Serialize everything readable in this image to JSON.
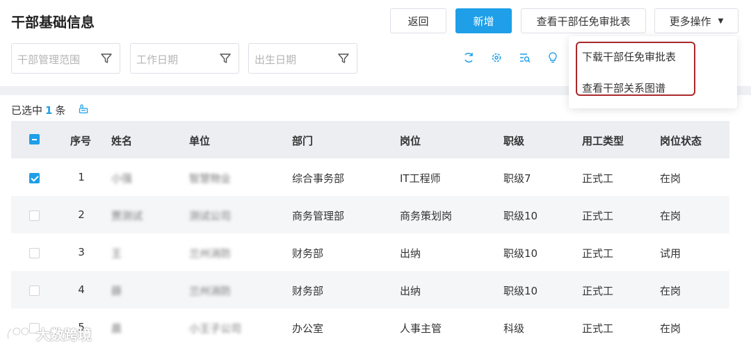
{
  "header": {
    "title": "干部基础信息"
  },
  "toolbar": {
    "back_label": "返回",
    "add_label": "新增",
    "view_approval_label": "查看干部任免审批表",
    "more_label": "更多操作"
  },
  "filters": {
    "scope_placeholder": "干部管理范围",
    "work_date_placeholder": "工作日期",
    "birth_date_placeholder": "出生日期"
  },
  "tools": {
    "icons": [
      "refresh-icon",
      "settings-icon",
      "search-list-icon",
      "bulb-icon"
    ]
  },
  "selection": {
    "prefix": "已选中",
    "count": "1",
    "suffix": "条"
  },
  "table": {
    "headers": {
      "index": "序号",
      "name": "姓名",
      "unit": "单位",
      "dept": "部门",
      "post": "岗位",
      "level": "职级",
      "employment": "用工类型",
      "status": "岗位状态"
    },
    "rows": [
      {
        "checked": true,
        "index": "1",
        "name": "小强",
        "unit": "智慧物业",
        "dept": "综合事务部",
        "post": "IT工程师",
        "level": "职级7",
        "employment": "正式工",
        "status": "在岗"
      },
      {
        "checked": false,
        "index": "2",
        "name": "贾测试",
        "unit": "测试公司",
        "dept": "商务管理部",
        "post": "商务策划岗",
        "level": "职级10",
        "employment": "正式工",
        "status": "在岗"
      },
      {
        "checked": false,
        "index": "3",
        "name": "王",
        "unit": "兰州消防",
        "dept": "财务部",
        "post": "出纳",
        "level": "职级10",
        "employment": "正式工",
        "status": "试用"
      },
      {
        "checked": false,
        "index": "4",
        "name": "薛",
        "unit": "兰州消防",
        "dept": "财务部",
        "post": "出纳",
        "level": "职级10",
        "employment": "正式工",
        "status": "在岗"
      },
      {
        "checked": false,
        "index": "5",
        "name": "晨",
        "unit": "小王子公司",
        "dept": "办公室",
        "post": "人事主管",
        "level": "科级",
        "employment": "正式工",
        "status": "在岗"
      }
    ]
  },
  "dropdown": {
    "items": [
      "下载干部任免审批表",
      "查看干部关系图谱"
    ]
  },
  "watermark": {
    "text": "大数跨境"
  },
  "colors": {
    "primary": "#1e9fe8",
    "highlight_outline": "#a8272a",
    "header_bg": "#eceef2"
  }
}
